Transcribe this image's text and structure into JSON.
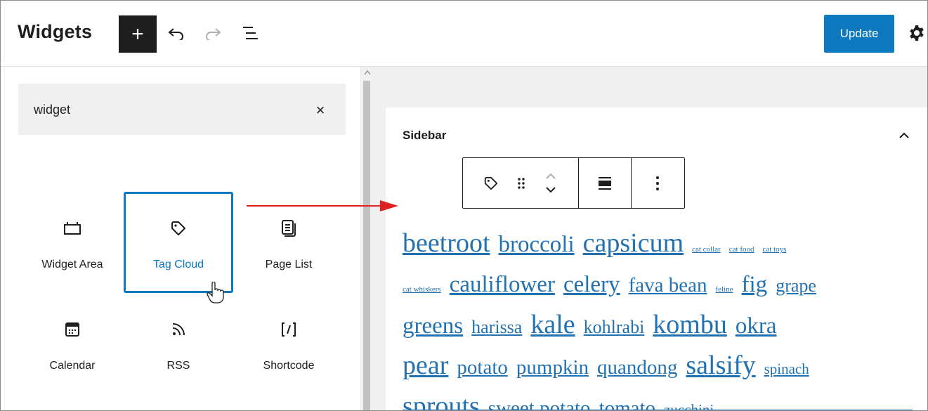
{
  "header": {
    "title": "Widgets",
    "inserter_symbol": "+",
    "update_label": "Update"
  },
  "search": {
    "value": "widget",
    "clear_symbol": "×"
  },
  "blocks": [
    {
      "label": "Widget Area",
      "icon": "widget-area-icon"
    },
    {
      "label": "Tag Cloud",
      "icon": "tag-icon",
      "selected": true
    },
    {
      "label": "Page List",
      "icon": "page-list-icon"
    },
    {
      "label": "Calendar",
      "icon": "calendar-icon"
    },
    {
      "label": "RSS",
      "icon": "rss-icon"
    },
    {
      "label": "Shortcode",
      "icon": "shortcode-icon"
    }
  ],
  "editor": {
    "area_title": "Sidebar"
  },
  "tag_cloud": {
    "tags": [
      "beetroot",
      "broccoli",
      "capsicum",
      "cat collar",
      "cat food",
      "cat toys",
      "cat whiskers",
      "cauliflower",
      "celery",
      "fava bean",
      "feline",
      "fig",
      "grape",
      "greens",
      "harissa",
      "kale",
      "kohlrabi",
      "kombu",
      "okra",
      "pear",
      "potato",
      "pumpkin",
      "quandong",
      "salsify",
      "spinach",
      "sprouts",
      "sweet potato",
      "tomato",
      "zucchini"
    ]
  },
  "colors": {
    "accent": "#0b78bf",
    "link": "#2271b1",
    "annotation_arrow": "#e02020"
  }
}
